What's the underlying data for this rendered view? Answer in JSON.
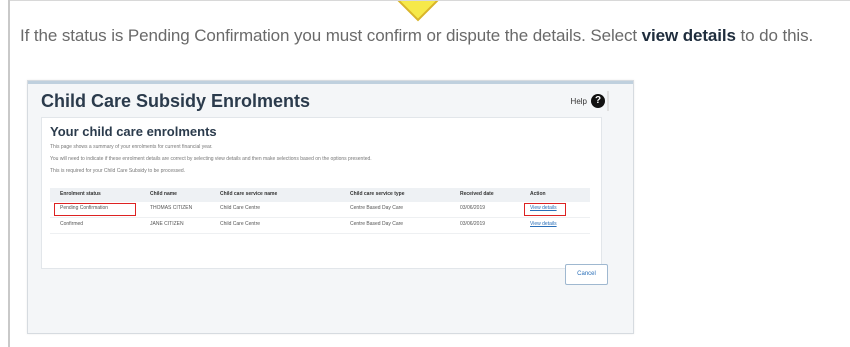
{
  "instruction": {
    "prefix": "If the status is Pending Confirmation you must confirm or dispute the details. Select ",
    "bold": "view details",
    "suffix": " to do this."
  },
  "panel": {
    "title": "Child Care Subsidy Enrolments",
    "help_label": "Help"
  },
  "card": {
    "title": "Your child care enrolments",
    "lines": [
      "This page shows a summary of your enrolments for current financial year.",
      "You will need to indicate if these enrolment details are correct by selecting view details and then make selections based on the options presented.",
      "This is required for your Child Care Subsidy to be processed."
    ]
  },
  "table": {
    "headers": [
      "Enrolment status",
      "Child name",
      "Child care service name",
      "Child care service type",
      "Received date",
      "Action"
    ],
    "rows": [
      [
        "Pending Confirmation",
        "THOMAS CITIZEN",
        "Child Care Centre",
        "Centre Based Day Care",
        "03/06/2019",
        "View details"
      ],
      [
        "Confirmed",
        "JANE CITIZEN",
        "Child Care Centre",
        "Centre Based Day Care",
        "03/06/2019",
        "View details"
      ]
    ]
  },
  "cancel_label": "Cancel",
  "colors": {
    "arrow_fill": "#f6e94a",
    "arrow_stroke": "#d9b52a",
    "highlight": "#d22222",
    "link": "#2a6fb8"
  }
}
